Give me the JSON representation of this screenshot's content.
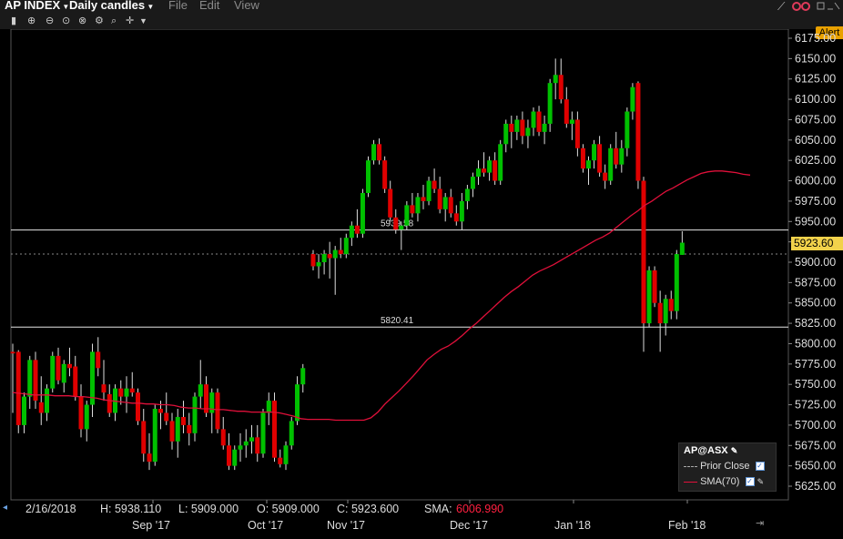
{
  "app": {
    "symbol": "AP INDEX",
    "chart_type_label": "Daily candles",
    "menu": [
      "File",
      "Edit",
      "View"
    ],
    "alert_label": "Alert",
    "scroll_left_glyph": "◂",
    "scroll_right_glyph": "▸",
    "legend_icon_glyph": "🖊",
    "checkmark_glyph": "✓"
  },
  "toolbar_icons": [
    "cursor-icon",
    "zoom-in-icon",
    "zoom-out-icon",
    "zoom-fit-icon",
    "zoom-region-icon",
    "settings-icon",
    "dropdown-icon"
  ],
  "legend": {
    "title": "AP@ASX",
    "prior_close_label": "Prior Close",
    "sma_label": "SMA(70)"
  },
  "status": {
    "date": "2/16/2018",
    "high": "H: 5938.110",
    "low": "L: 5909.000",
    "open": "O: 5909.000",
    "close": "C: 5923.600",
    "sma_label": "SMA:",
    "sma_value": "6006.990"
  },
  "colors": {
    "up": "#00c000",
    "down": "#e00000",
    "sma": "#e0103a",
    "grid": "#444444",
    "last_price_bg": "#f2d24b",
    "alert": "#e9a100"
  },
  "chart_data": {
    "type": "candlestick",
    "y_axis_ticks": [
      "6175.00",
      "6150.00",
      "6125.00",
      "6100.00",
      "6075.00",
      "6050.00",
      "6025.00",
      "6000.00",
      "5975.00",
      "5950.00",
      "5925.00",
      "5900.00",
      "5875.00",
      "5850.00",
      "5825.00",
      "5800.00",
      "5775.00",
      "5750.00",
      "5725.00",
      "5700.00",
      "5675.00",
      "5650.00",
      "5625.00"
    ],
    "x_axis_labels": [
      "Sep '17",
      "Oct '17",
      "Nov '17",
      "Dec '17",
      "Jan '18",
      "Feb '18"
    ],
    "ylim": [
      5612,
      6185
    ],
    "last_price": "5923.60",
    "prior_close": 5910,
    "horizontal_lines": [
      {
        "value": 5939.58,
        "label": "5939.58"
      },
      {
        "value": 5820.41,
        "label": "5820.41"
      }
    ],
    "series": [
      {
        "name": "AP@ASX",
        "ohlc": [
          [
            5790,
            5800,
            5715,
            5788
          ],
          [
            5790,
            5792,
            5690,
            5700
          ],
          [
            5700,
            5740,
            5690,
            5735
          ],
          [
            5735,
            5785,
            5720,
            5780
          ],
          [
            5780,
            5790,
            5720,
            5730
          ],
          [
            5728,
            5760,
            5700,
            5715
          ],
          [
            5715,
            5750,
            5705,
            5745
          ],
          [
            5745,
            5790,
            5740,
            5785
          ],
          [
            5785,
            5795,
            5750,
            5755
          ],
          [
            5752,
            5780,
            5740,
            5775
          ],
          [
            5775,
            5795,
            5760,
            5770
          ],
          [
            5772,
            5785,
            5730,
            5735
          ],
          [
            5735,
            5750,
            5685,
            5695
          ],
          [
            5695,
            5730,
            5680,
            5725
          ],
          [
            5725,
            5800,
            5710,
            5790
          ],
          [
            5790,
            5808,
            5760,
            5770
          ],
          [
            5750,
            5780,
            5730,
            5740
          ],
          [
            5738,
            5750,
            5710,
            5715
          ],
          [
            5715,
            5750,
            5705,
            5745
          ],
          [
            5745,
            5755,
            5725,
            5735
          ],
          [
            5735,
            5760,
            5715,
            5745
          ],
          [
            5745,
            5765,
            5735,
            5740
          ],
          [
            5740,
            5745,
            5700,
            5705
          ],
          [
            5705,
            5720,
            5655,
            5665
          ],
          [
            5665,
            5690,
            5645,
            5655
          ],
          [
            5655,
            5725,
            5650,
            5720
          ],
          [
            5720,
            5730,
            5695,
            5715
          ],
          [
            5715,
            5740,
            5700,
            5705
          ],
          [
            5705,
            5715,
            5670,
            5680
          ],
          [
            5680,
            5720,
            5660,
            5710
          ],
          [
            5710,
            5730,
            5690,
            5700
          ],
          [
            5700,
            5715,
            5675,
            5690
          ],
          [
            5690,
            5740,
            5680,
            5735
          ],
          [
            5735,
            5780,
            5720,
            5750
          ],
          [
            5750,
            5760,
            5710,
            5715
          ],
          [
            5715,
            5745,
            5690,
            5740
          ],
          [
            5740,
            5745,
            5690,
            5695
          ],
          [
            5695,
            5710,
            5670,
            5675
          ],
          [
            5675,
            5690,
            5645,
            5650
          ],
          [
            5650,
            5675,
            5645,
            5670
          ],
          [
            5670,
            5690,
            5655,
            5675
          ],
          [
            5675,
            5695,
            5660,
            5680
          ],
          [
            5680,
            5700,
            5665,
            5685
          ],
          [
            5685,
            5700,
            5655,
            5665
          ],
          [
            5665,
            5720,
            5660,
            5715
          ],
          [
            5715,
            5740,
            5700,
            5730
          ],
          [
            5730,
            5740,
            5655,
            5660
          ],
          [
            5660,
            5670,
            5648,
            5652
          ],
          [
            5652,
            5680,
            5645,
            5675
          ],
          [
            5675,
            5710,
            5670,
            5705
          ],
          [
            5705,
            5760,
            5700,
            5750
          ],
          [
            5750,
            5775,
            5740,
            5770
          ],
          [
            5910,
            5915,
            5890,
            5895
          ],
          [
            5895,
            5910,
            5880,
            5900
          ],
          [
            5900,
            5915,
            5885,
            5910
          ],
          [
            5910,
            5925,
            5880,
            5905
          ],
          [
            5905,
            5920,
            5860,
            5915
          ],
          [
            5915,
            5930,
            5905,
            5910
          ],
          [
            5910,
            5935,
            5905,
            5930
          ],
          [
            5930,
            5950,
            5920,
            5945
          ],
          [
            5945,
            5965,
            5930,
            5935
          ],
          [
            5935,
            5990,
            5930,
            5985
          ],
          [
            5985,
            6030,
            5980,
            6025
          ],
          [
            6025,
            6050,
            6020,
            6045
          ],
          [
            6045,
            6052,
            6020,
            6025
          ],
          [
            6025,
            6030,
            5985,
            5990
          ],
          [
            5990,
            6000,
            5950,
            5955
          ],
          [
            5955,
            5965,
            5935,
            5940
          ],
          [
            5940,
            5950,
            5915,
            5945
          ],
          [
            5945,
            5975,
            5940,
            5970
          ],
          [
            5970,
            5985,
            5955,
            5960
          ],
          [
            5960,
            5985,
            5950,
            5980
          ],
          [
            5980,
            5995,
            5965,
            5975
          ],
          [
            5975,
            6005,
            5970,
            6000
          ],
          [
            6000,
            6015,
            5985,
            5990
          ],
          [
            5990,
            6005,
            5960,
            5965
          ],
          [
            5965,
            5985,
            5950,
            5980
          ],
          [
            5980,
            5990,
            5955,
            5960
          ],
          [
            5960,
            5970,
            5945,
            5950
          ],
          [
            5950,
            5985,
            5940,
            5975
          ],
          [
            5975,
            5995,
            5965,
            5990
          ],
          [
            5990,
            6010,
            5980,
            6005
          ],
          [
            6005,
            6025,
            5995,
            6015
          ],
          [
            6015,
            6035,
            6005,
            6010
          ],
          [
            6010,
            6030,
            6000,
            6025
          ],
          [
            6025,
            6035,
            5995,
            6000
          ],
          [
            6000,
            6050,
            5995,
            6045
          ],
          [
            6045,
            6075,
            6035,
            6070
          ],
          [
            6070,
            6080,
            6040,
            6060
          ],
          [
            6060,
            6080,
            6050,
            6075
          ],
          [
            6075,
            6085,
            6045,
            6055
          ],
          [
            6055,
            6075,
            6040,
            6065
          ],
          [
            6065,
            6090,
            6055,
            6085
          ],
          [
            6085,
            6092,
            6055,
            6060
          ],
          [
            6060,
            6080,
            6045,
            6070
          ],
          [
            6070,
            6125,
            6060,
            6120
          ],
          [
            6120,
            6150,
            6100,
            6130
          ],
          [
            6130,
            6150,
            6095,
            6100
          ],
          [
            6100,
            6115,
            6065,
            6070
          ],
          [
            6070,
            6085,
            6050,
            6075
          ],
          [
            6075,
            6085,
            6030,
            6040
          ],
          [
            6040,
            6045,
            6010,
            6015
          ],
          [
            6015,
            6030,
            5995,
            6025
          ],
          [
            6025,
            6050,
            6015,
            6045
          ],
          [
            6045,
            6055,
            6005,
            6010
          ],
          [
            6010,
            6020,
            5990,
            6000
          ],
          [
            6000,
            6045,
            5995,
            6040
          ],
          [
            6040,
            6060,
            6015,
            6020
          ],
          [
            6020,
            6050,
            6010,
            6040
          ],
          [
            6040,
            6090,
            6030,
            6085
          ],
          [
            6085,
            6120,
            6075,
            6115
          ],
          [
            6120,
            6122,
            5990,
            6000
          ],
          [
            6000,
            6005,
            5790,
            5825
          ],
          [
            5825,
            5895,
            5820,
            5890
          ],
          [
            5890,
            5895,
            5845,
            5850
          ],
          [
            5850,
            5865,
            5790,
            5825
          ],
          [
            5825,
            5860,
            5810,
            5855
          ],
          [
            5855,
            5865,
            5830,
            5840
          ],
          [
            5840,
            5915,
            5830,
            5910
          ],
          [
            5909,
            5938,
            5909,
            5924
          ]
        ]
      },
      {
        "name": "SMA(70)",
        "values": [
          5740,
          5739,
          5738,
          5737,
          5737,
          5737,
          5736,
          5736,
          5736,
          5735,
          5735,
          5734,
          5733,
          5731,
          5730,
          5729,
          5728,
          5727,
          5727,
          5726,
          5726,
          5725,
          5725,
          5724,
          5722,
          5721,
          5721,
          5720,
          5720,
          5719,
          5719,
          5718,
          5717,
          5717,
          5716,
          5716,
          5716,
          5716,
          5715,
          5713,
          5711,
          5708,
          5707,
          5707,
          5707,
          5707,
          5706,
          5706,
          5706,
          5706,
          5706,
          5709,
          5716,
          5726,
          5734,
          5742,
          5751,
          5760,
          5770,
          5780,
          5787,
          5793,
          5797,
          5803,
          5810,
          5818,
          5825,
          5833,
          5841,
          5849,
          5857,
          5864,
          5870,
          5877,
          5884,
          5889,
          5893,
          5897,
          5902,
          5907,
          5912,
          5917,
          5922,
          5927,
          5931,
          5936,
          5943,
          5950,
          5957,
          5963,
          5970,
          5975,
          5981,
          5987,
          5991,
          5996,
          6001,
          6005,
          6009,
          6011,
          6012,
          6012,
          6011,
          6010,
          6008,
          6007
        ]
      }
    ]
  }
}
